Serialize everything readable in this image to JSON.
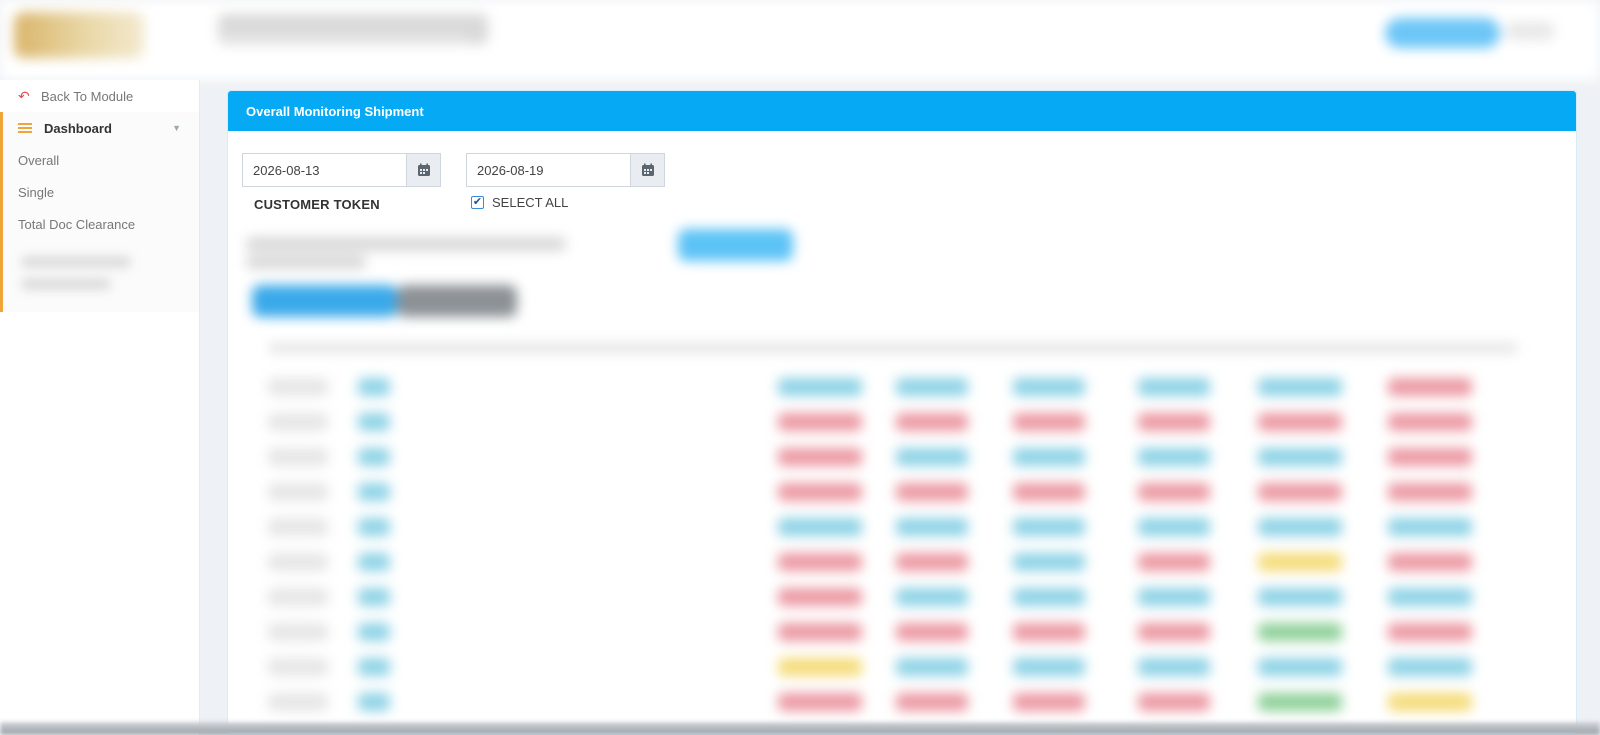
{
  "sidebar": {
    "back_label": "Back To Module",
    "dashboard_label": "Dashboard",
    "sub_items": [
      "Overall",
      "Single",
      "Total Doc Clearance"
    ]
  },
  "panel": {
    "title": "Overall Monitoring Shipment",
    "start_date": "2026-08-13",
    "end_date": "2026-08-19",
    "customer_token_label": "CUSTOMER TOKEN",
    "select_all_label": "SELECT ALL",
    "select_all_checked": true
  },
  "colors": {
    "accent": "#06a9f4",
    "sidebar_accent": "#f0a53b",
    "status_blue": "#8fd3e6",
    "status_red": "#ec9aa4",
    "status_yellow": "#f5dc7a",
    "status_green": "#8fd19a"
  },
  "icons": {
    "back": "back-arrow-icon",
    "dashboard": "list-icon",
    "calendar": "calendar-icon",
    "caret": "chevron-down-icon"
  }
}
